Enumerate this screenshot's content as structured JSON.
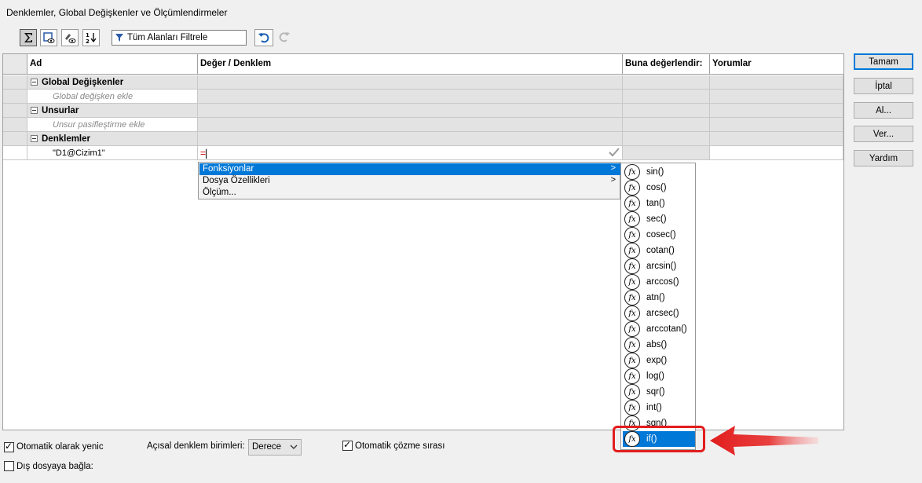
{
  "window": {
    "title": "Denklemler, Global Değişkenler ve Ölçümlendirmeler"
  },
  "toolbar": {
    "filter_text": "Tüm Alanları Filtrele"
  },
  "table": {
    "headers": [
      "Ad",
      "Değer / Denklem",
      "Buna değerlendir:",
      "Yorumlar"
    ],
    "groups": [
      {
        "label": "Global Değişkenler",
        "hint": "Global değişken ekle"
      },
      {
        "label": "Unsurlar",
        "hint": "Unsur pasifleştirme ekle"
      },
      {
        "label": "Denklemler"
      }
    ],
    "equation_row": {
      "name": "\"D1@Cizim1\"",
      "value": "="
    }
  },
  "buttons": {
    "ok": "Tamam",
    "cancel": "İptal",
    "import": "Al...",
    "export": "Ver...",
    "help": "Yardım"
  },
  "context_menu": {
    "items": [
      {
        "label": "Fonksiyonlar",
        "arrow": ">"
      },
      {
        "label": "Dosya Özellikleri",
        "arrow": ">"
      },
      {
        "label": "Ölçüm..."
      }
    ]
  },
  "functions": {
    "icon_text": "fx",
    "items": [
      "sin()",
      "cos()",
      "tan()",
      "sec()",
      "cosec()",
      "cotan()",
      "arcsin()",
      "arccos()",
      "atn()",
      "arcsec()",
      "arccotan()",
      "abs()",
      "exp()",
      "log()",
      "sqr()",
      "int()",
      "sgn()",
      "if()"
    ],
    "selected": "if()"
  },
  "bottom": {
    "auto_rebuild": "Otomatik olarak yenic",
    "angle_units_label": "Açısal denklem birimleri:",
    "angle_units_value": "Derece",
    "auto_solve": "Otomatik çözme sırası",
    "link_external": "Dış dosyaya bağla:"
  },
  "colors": {
    "selection": "#0078d7",
    "annotation": "#e21d1d"
  }
}
